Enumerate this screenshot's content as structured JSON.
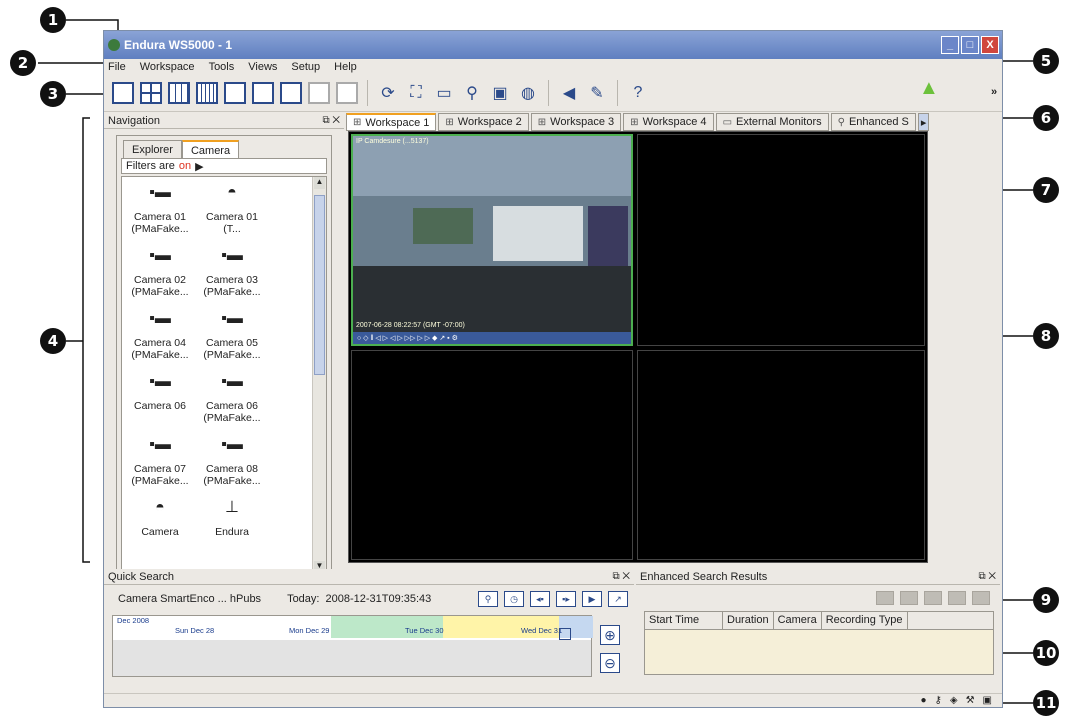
{
  "callouts": [
    "1",
    "2",
    "3",
    "4",
    "5",
    "6",
    "7",
    "8",
    "9",
    "10",
    "11"
  ],
  "window": {
    "title": "Endura WS5000 - 1",
    "buttons": [
      "_",
      "□",
      "X"
    ]
  },
  "menu": [
    "File",
    "Workspace",
    "Tools",
    "Views",
    "Setup",
    "Help"
  ],
  "toolbar": {
    "layout_icons": [
      "1x1-layout-icon",
      "2x2-layout-icon",
      "3x3-layout-icon",
      "4x4-layout-icon",
      "1+5-layout-icon",
      "1+7-layout-icon",
      "1+12-layout-icon",
      "disabled-layout-icon",
      "disabled-layout-icon"
    ],
    "tool_icons": [
      "playback-icon",
      "fit-icon",
      "monitor-icon",
      "search-icon",
      "capture-icon",
      "globe-icon",
      "speaker-icon",
      "wrench-icon",
      "help-icon"
    ],
    "overflow": "»",
    "alarm_icon": "bell-icon",
    "alarm_color": "#6cc13b"
  },
  "navigation": {
    "title": "Navigation",
    "subtabs": [
      "Explorer",
      "Camera"
    ],
    "filters_label": "Filters are",
    "filters_state": "on",
    "cameras": [
      {
        "icon": "box-camera-icon",
        "label": "Camera 01 (PMaFake..."
      },
      {
        "icon": "dome-camera-icon",
        "label": "Camera 01 (T..."
      },
      {
        "icon": "box-camera-icon",
        "label": "Camera 02 (PMaFake..."
      },
      {
        "icon": "box-camera-icon",
        "label": "Camera 03 (PMaFake..."
      },
      {
        "icon": "box-camera-icon",
        "label": "Camera 04 (PMaFake..."
      },
      {
        "icon": "box-camera-icon",
        "label": "Camera 05 (PMaFake..."
      },
      {
        "icon": "box-camera-icon",
        "label": "Camera 06"
      },
      {
        "icon": "box-camera-icon",
        "label": "Camera 06 (PMaFake..."
      },
      {
        "icon": "box-camera-icon",
        "label": "Camera 07 (PMaFake..."
      },
      {
        "icon": "box-camera-icon",
        "label": "Camera 08 (PMaFake..."
      },
      {
        "icon": "dome-camera-icon",
        "label": "Camera"
      },
      {
        "icon": "endura-device-icon",
        "label": "Endura"
      }
    ]
  },
  "workspace_tabs": [
    "Workspace 1",
    "Workspace 2",
    "Workspace 3",
    "Workspace 4",
    "External Monitors",
    "Enhanced S"
  ],
  "video": {
    "camera_label": "IP Camdesure (...5137)",
    "timestamp": "2007-06-28 08:22:57 (GMT -07:00)",
    "controls": "○ ◇ ‖ ◁ ▷ ◁ ▷ ▷▷ ▷ ▷ ◆ ↗ ▪ ⚙"
  },
  "quick_search": {
    "title": "Quick Search",
    "camera": "Camera SmartEnco ... hPubs",
    "today_label": "Today:",
    "today_value": "2008-12-31T09:35:43",
    "timeline_labels": [
      "Dec 2008",
      "Sun Dec 28",
      "Mon Dec 29",
      "Tue Dec 30",
      "Wed Dec 31"
    ],
    "zoom_in": "⊕",
    "zoom_out": "⊖"
  },
  "enhanced_search": {
    "title": "Enhanced Search Results",
    "columns": [
      "Start Time",
      "Duration",
      "Camera",
      "Recording Type"
    ]
  },
  "status_icons": [
    "person-icon",
    "key-icon",
    "shield-icon",
    "tools-icon",
    "window-icon"
  ]
}
